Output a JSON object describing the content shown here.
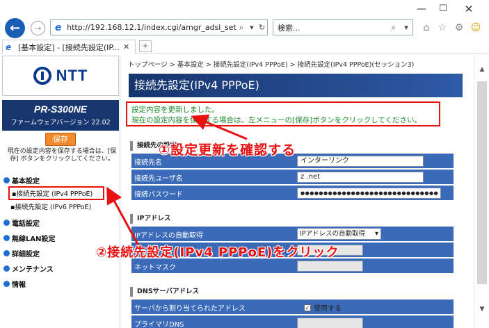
{
  "browser": {
    "address_url": "http://192.168.12.1/index.cgi/amgr_adsl_set",
    "search_placeholder": "検索...",
    "tab_title": "[基本設定] - [接続先設定(IP..."
  },
  "sidebar": {
    "logo_text": "NTT",
    "model_name": "PR-S300NE",
    "firmware_label": "ファームウェアバージョン 22.02",
    "save_button": "保存",
    "save_note": "現在の設定内容を保存する場合は、[保存] ボタンをクリックしてください。",
    "menu": [
      {
        "label": "基本設定",
        "sub": [
          "接続先設定 (IPv4 PPPoE)",
          "接続先設定 (IPv6 PPPoE)"
        ]
      },
      {
        "label": "電話設定",
        "sub": []
      },
      {
        "label": "無線LAN設定",
        "sub": []
      },
      {
        "label": "詳細設定",
        "sub": []
      },
      {
        "label": "メンテナンス",
        "sub": []
      },
      {
        "label": "情報",
        "sub": []
      }
    ]
  },
  "main": {
    "breadcrumb": "トップページ > 基本設定 > 接続先設定(IPv4 PPPoE) > 接続先設定(IPv4 PPPoE)(セッション3)",
    "title": "接続先設定(IPv4 PPPoE)",
    "message_line1": "設定内容を更新しました。",
    "message_line2": "現在の設定内容を保存する場合は、左メニューの[保存]ボタンをクリックしてください。",
    "section_connection": "接続先の設定",
    "connection_name_label": "接続先名",
    "connection_name_value": "インターリンク",
    "username_label": "接続先ユーザ名",
    "username_value": "z            .net",
    "password_label": "接続パスワード",
    "password_value": "●●●●●●●●●●●●●●●●●●●●●●●●●●●●●●",
    "section_ip": "IPアドレス",
    "ip_method_label": "IPアドレスの自動取得",
    "ip_method_value": "IPアドレスの自動取得",
    "netmask_label": "ネットマスク",
    "section_dns": "DNSサーバアドレス",
    "dns_auto_label": "サーバから割り当てられたアドレス",
    "dns_auto_value": "使用する",
    "primary_dns_label": "プライマリDNS"
  },
  "annotations": {
    "step1": "①設定更新を確認する",
    "step2": "②接続先設定(IPv4 PPPoE)をクリック"
  },
  "colors": {
    "accent_red": "#e81010",
    "navy": "#17356e",
    "row_blue": "#3a6ab8",
    "message_green": "#1a8a2a",
    "save_orange": "#f28a2e"
  }
}
